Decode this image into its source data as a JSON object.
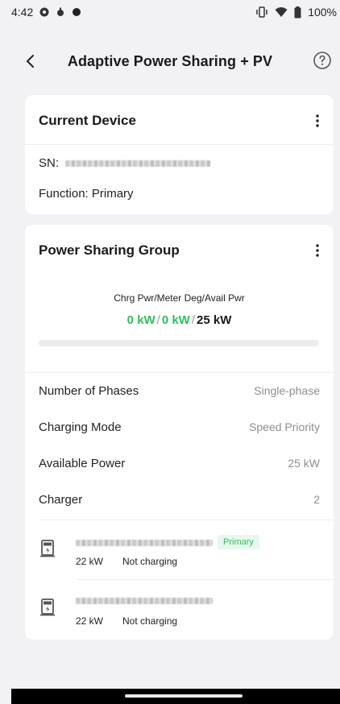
{
  "status_bar": {
    "time": "4:42",
    "battery": "100%"
  },
  "header": {
    "title": "Adaptive Power Sharing + PV"
  },
  "current_device": {
    "title": "Current Device",
    "sn_label": "SN:",
    "function_text": "Function: Primary"
  },
  "power_sharing": {
    "title": "Power Sharing Group",
    "summary_label": "Chrg Pwr/Meter Deg/Avail Pwr",
    "charging_power": "0 kW",
    "meter_deg": "0 kW",
    "available": "25 kW",
    "slash": "/",
    "progress_fraction": 0,
    "rows": [
      {
        "label": "Number of Phases",
        "value": "Single-phase"
      },
      {
        "label": "Charging Mode",
        "value": "Speed Priority"
      },
      {
        "label": "Available Power",
        "value": "25 kW"
      },
      {
        "label": "Charger",
        "value": "2"
      }
    ],
    "chargers": [
      {
        "power": "22 kW",
        "status": "Not charging",
        "badge": "Primary"
      },
      {
        "power": "22 kW",
        "status": "Not charging",
        "badge": ""
      }
    ]
  },
  "colors": {
    "accent_green": "#2ec05a",
    "background": "#f2f2f4",
    "card": "#ffffff"
  },
  "icons": [
    "back-arrow-icon",
    "help-circle-icon",
    "more-vertical-icon",
    "ev-charger-icon",
    "wifi-icon",
    "battery-icon",
    "vibrate-icon"
  ]
}
